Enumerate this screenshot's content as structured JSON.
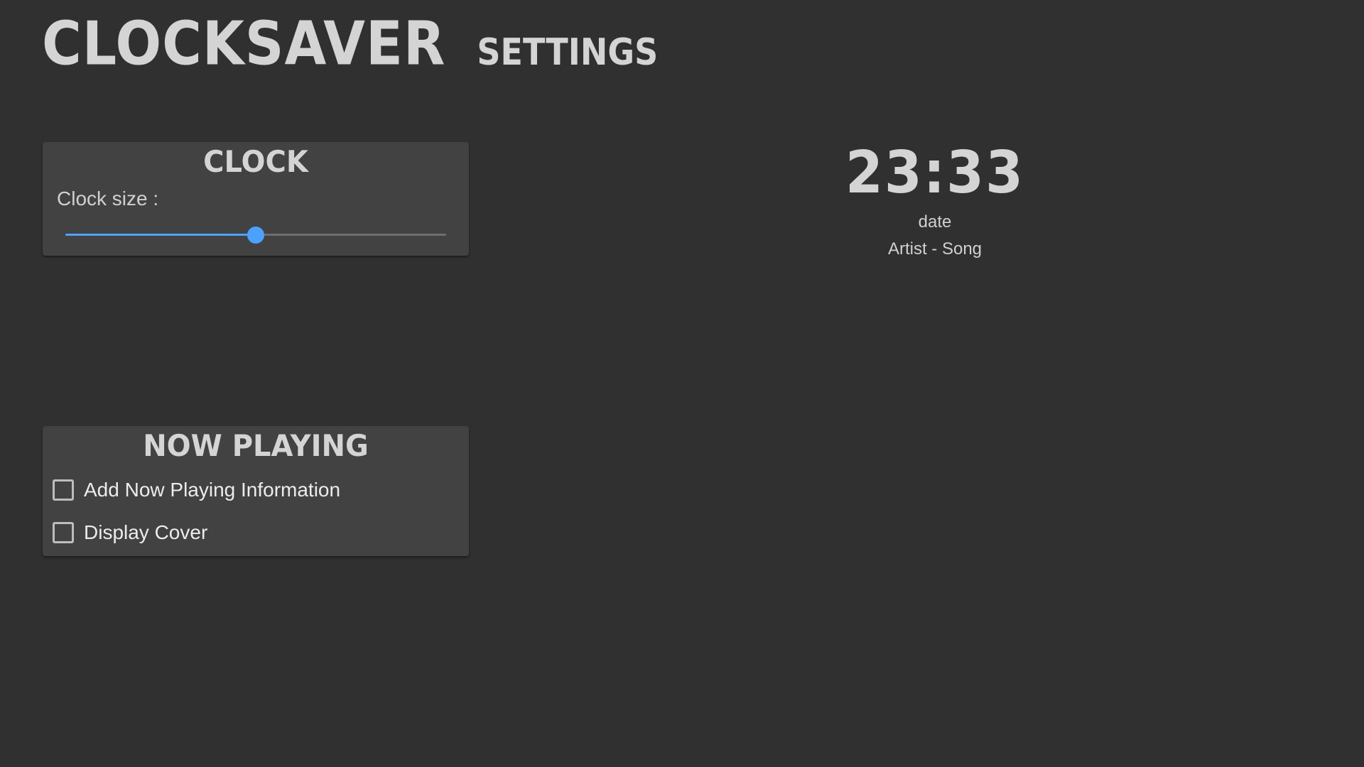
{
  "header": {
    "app_title": "CLOCKSAVER",
    "page_title": "SETTINGS"
  },
  "clock_card": {
    "title": "CLOCK",
    "clock_size_label": "Clock size :",
    "clock_size_slider_fraction": 0.5
  },
  "now_playing_card": {
    "title": "NOW PLAYING",
    "options": [
      {
        "label": "Add Now Playing Information",
        "checked": false
      },
      {
        "label": "Display Cover",
        "checked": false
      }
    ]
  },
  "preview": {
    "time": "23:33",
    "date": "date",
    "song": "Artist - Song"
  },
  "colors": {
    "background": "#303030",
    "card": "#424242",
    "accent": "#4aa2ff",
    "text": "#d4d4d4"
  }
}
